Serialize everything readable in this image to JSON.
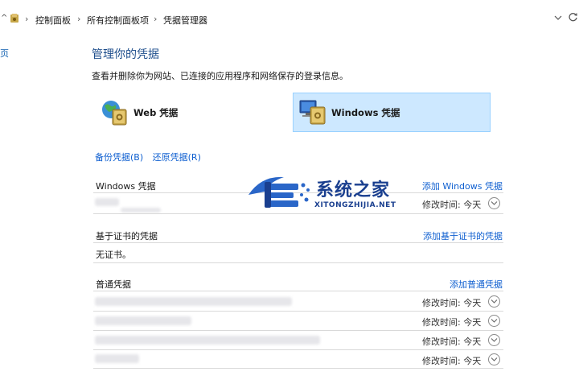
{
  "breadcrumb": {
    "items": [
      "控制面板",
      "所有控制面板项",
      "凭据管理器"
    ],
    "separator": "›"
  },
  "page": {
    "title": "管理你的凭据",
    "subtitle": "查看并删除你为网站、已连接的应用程序和网络保存的登录信息。",
    "left_edge_char": "页"
  },
  "categories": {
    "web": {
      "label": "Web 凭据",
      "selected": false
    },
    "windows": {
      "label": "Windows 凭据",
      "selected": true
    }
  },
  "actions": {
    "backup": "备份凭据(B)",
    "restore": "还原凭据(R)"
  },
  "sections": {
    "windows": {
      "title": "Windows 凭据",
      "add": "添加 Windows 凭据",
      "rows": [
        {
          "modified": "修改时间: 今天"
        }
      ]
    },
    "cert": {
      "title": "基于证书的凭据",
      "add": "添加基于证书的凭据",
      "empty": "无证书。"
    },
    "generic": {
      "title": "普通凭据",
      "add": "添加普通凭据",
      "rows": [
        {
          "modified": "修改时间: 今天"
        },
        {
          "modified": "修改时间: 今天"
        },
        {
          "modified": "修改时间: 今天"
        },
        {
          "modified": "修改时间: 今天"
        }
      ]
    }
  },
  "watermark": {
    "title": "系统之家",
    "subtitle": "XITONGZHIJIA.NET"
  },
  "colors": {
    "link": "#1060d0",
    "heading": "#1e4e8c",
    "selected_bg": "#cde8ff",
    "watermark": "#1a3f8f"
  }
}
